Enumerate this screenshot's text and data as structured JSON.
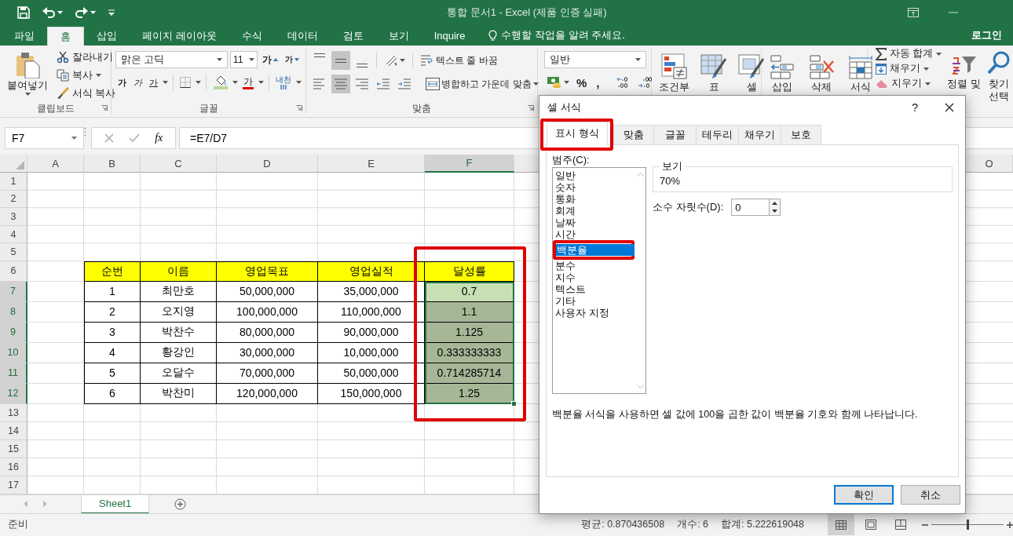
{
  "title_bar": {
    "title": "통합 문서1 - Excel (제품 인증 실패)"
  },
  "ribbon_tabs": [
    {
      "label": "파일",
      "selected": false
    },
    {
      "label": "홈",
      "selected": true
    },
    {
      "label": "삽입",
      "selected": false
    },
    {
      "label": "페이지 레이아웃",
      "selected": false
    },
    {
      "label": "수식",
      "selected": false
    },
    {
      "label": "데이터",
      "selected": false
    },
    {
      "label": "검토",
      "selected": false
    },
    {
      "label": "보기",
      "selected": false
    },
    {
      "label": "Inquire",
      "selected": false
    }
  ],
  "tell_me": {
    "placeholder": "수행할 작업을 알려 주세요."
  },
  "sign_in": "로그인",
  "clipboard": {
    "paste": "붙여넣기",
    "cut": "잘라내기",
    "copy": "복사",
    "format_painter": "서식 복사",
    "label": "클립보드"
  },
  "font": {
    "name": "맑은 고딕",
    "size": "11",
    "grow": "가",
    "shrink": "가",
    "bold": "가",
    "italic": "가",
    "underline": "가",
    "color_button": "가",
    "phonetic": "내천",
    "label": "글꼴"
  },
  "alignment": {
    "vertical": [
      {
        "kind": "top",
        "selected": false
      },
      {
        "kind": "middle",
        "selected": true
      },
      {
        "kind": "bottom",
        "selected": false
      }
    ],
    "horizontal": [
      {
        "kind": "left",
        "selected": false
      },
      {
        "kind": "center",
        "selected": true
      },
      {
        "kind": "right",
        "selected": false
      }
    ],
    "wrap": "텍스트 줄 바꿈",
    "merge": "병합하고 가운데 맞춤",
    "label": "맞춤"
  },
  "number": {
    "format": "일반",
    "percent": "%",
    "comma": ","
  },
  "styles": [
    "조건부",
    "표",
    "셀"
  ],
  "cells": [
    "삽입",
    "삭제",
    "서식"
  ],
  "editing": {
    "autosum": "자동 합계",
    "fill": "채우기",
    "clear": "지우기",
    "sort": "정렬 및",
    "find": "찾기",
    "find_2": "선택"
  },
  "formula_bar": {
    "name_box": "F7",
    "function_label": "fx",
    "formula": "=E7/D7"
  },
  "sheet": {
    "columns": [
      {
        "label": "A",
        "selected": false
      },
      {
        "label": "B",
        "selected": false
      },
      {
        "label": "C",
        "selected": false
      },
      {
        "label": "D",
        "selected": false
      },
      {
        "label": "E",
        "selected": false
      },
      {
        "label": "F",
        "selected": true
      },
      {
        "label": "O",
        "selected": false
      }
    ],
    "rows": [
      {
        "label": "1",
        "selected": false
      },
      {
        "label": "2",
        "selected": false
      },
      {
        "label": "3",
        "selected": false
      },
      {
        "label": "4",
        "selected": false
      },
      {
        "label": "5",
        "selected": false
      },
      {
        "label": "6",
        "selected": false
      },
      {
        "label": "7",
        "selected": true
      },
      {
        "label": "8",
        "selected": true
      },
      {
        "label": "9",
        "selected": true
      },
      {
        "label": "10",
        "selected": true
      },
      {
        "label": "11",
        "selected": true
      },
      {
        "label": "12",
        "selected": true
      },
      {
        "label": "13",
        "selected": false
      },
      {
        "label": "14",
        "selected": false
      },
      {
        "label": "15",
        "selected": false
      },
      {
        "label": "16",
        "selected": false
      },
      {
        "label": "17",
        "selected": false
      }
    ]
  },
  "table": {
    "header": [
      "순번",
      "이름",
      "영업목표",
      "영업실적",
      "달성률"
    ],
    "rows": [
      {
        "cells": [
          "1",
          "최만호",
          "50,000,000",
          "35,000,000",
          "0.7"
        ],
        "selected": true,
        "active": true
      },
      {
        "cells": [
          "2",
          "오지영",
          "100,000,000",
          "110,000,000",
          "1.1"
        ],
        "selected": true,
        "active": false
      },
      {
        "cells": [
          "3",
          "박찬수",
          "80,000,000",
          "90,000,000",
          "1.125"
        ],
        "selected": true,
        "active": false
      },
      {
        "cells": [
          "4",
          "황강인",
          "30,000,000",
          "10,000,000",
          "0.333333333"
        ],
        "selected": true,
        "active": false
      },
      {
        "cells": [
          "5",
          "오달수",
          "70,000,000",
          "50,000,000",
          "0.714285714"
        ],
        "selected": true,
        "active": false
      },
      {
        "cells": [
          "6",
          "박찬미",
          "120,000,000",
          "150,000,000",
          "1.25"
        ],
        "selected": true,
        "active": false
      }
    ]
  },
  "sheet_tabs": [
    {
      "label": "Sheet1",
      "selected": true
    }
  ],
  "status_bar": {
    "mode": "준비",
    "average": "평균: 0.870436508",
    "count": "개수: 6",
    "sum": "합계: 5.222619048",
    "views": [
      {
        "kind": "normal",
        "selected": true
      },
      {
        "kind": "page_layout",
        "selected": false
      },
      {
        "kind": "page_break",
        "selected": false
      }
    ],
    "zoom": {
      "level": 0.5
    }
  },
  "dialog": {
    "title": "셀 서식",
    "help": "?",
    "tabs": [
      {
        "label": "표시 형식",
        "selected": true
      },
      {
        "label": "맞춤",
        "selected": false
      },
      {
        "label": "글꼴",
        "selected": false
      },
      {
        "label": "테두리",
        "selected": false
      },
      {
        "label": "채우기",
        "selected": false
      },
      {
        "label": "보호",
        "selected": false
      }
    ],
    "category_label": "범주(C):",
    "categories": [
      {
        "label": "일반",
        "selected": false
      },
      {
        "label": "숫자",
        "selected": false
      },
      {
        "label": "통화",
        "selected": false
      },
      {
        "label": "회계",
        "selected": false
      },
      {
        "label": "날짜",
        "selected": false
      },
      {
        "label": "시간",
        "selected": false
      },
      {
        "label": "백분율",
        "selected": true
      },
      {
        "label": "분수",
        "selected": false
      },
      {
        "label": "지수",
        "selected": false
      },
      {
        "label": "텍스트",
        "selected": false
      },
      {
        "label": "기타",
        "selected": false
      },
      {
        "label": "사용자 지정",
        "selected": false
      }
    ],
    "sample_label": "보기",
    "sample": "70%",
    "decimal_label": "소수 자릿수(D):",
    "decimal_places": "0",
    "description": "백분율 서식을 사용하면 셀 값에 100을 곱한 값이 백분율 기호와 함께 나타납니다.",
    "buttons": [
      "확인",
      "취소"
    ]
  }
}
